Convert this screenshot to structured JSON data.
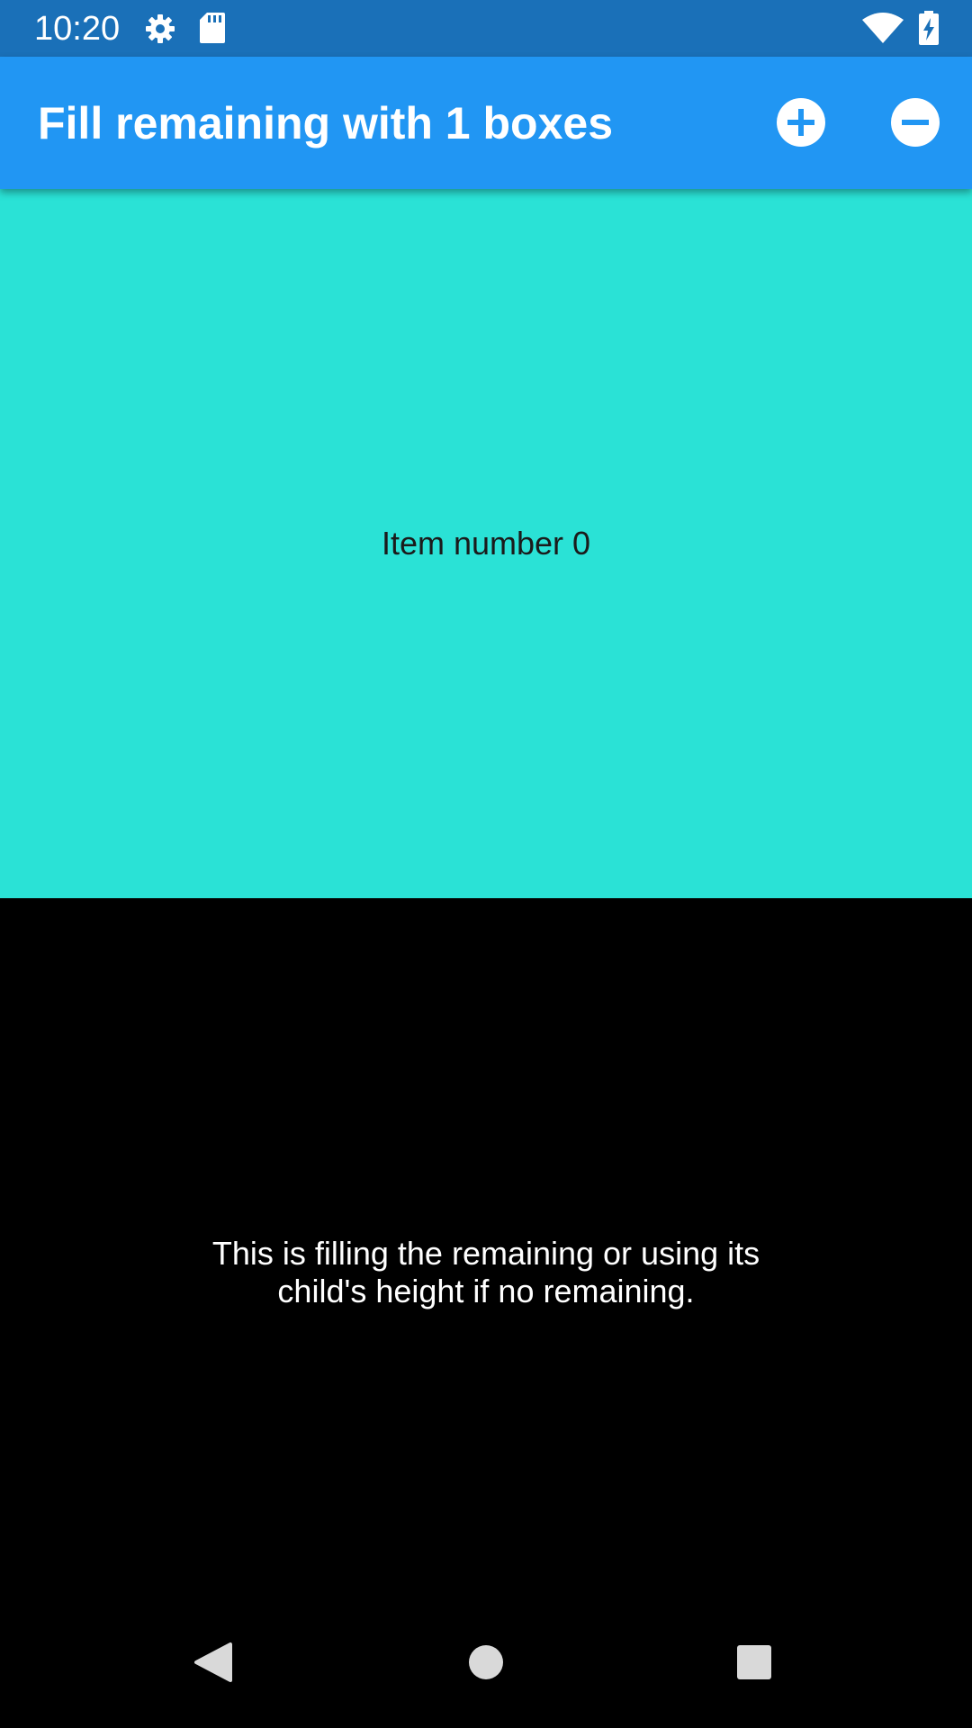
{
  "status_bar": {
    "time": "10:20",
    "left_icons": [
      "settings-gear-icon",
      "sd-card-icon"
    ],
    "right_icons": [
      "wifi-icon",
      "battery-charging-icon"
    ],
    "background": "#1a70b8"
  },
  "app_bar": {
    "title": "Fill remaining with 1 boxes",
    "background": "#2196f3",
    "actions": [
      {
        "name": "add",
        "icon": "add-circle-icon"
      },
      {
        "name": "remove",
        "icon": "remove-circle-icon"
      }
    ]
  },
  "content": {
    "item": {
      "label": "Item number 0",
      "color": "#2ae2d6"
    },
    "fill_remaining": {
      "text": "This is filling the remaining or using its child's height if no remaining.",
      "color": "#000000"
    }
  },
  "navigation_bar": {
    "buttons": [
      {
        "name": "back",
        "icon": "back-triangle-icon"
      },
      {
        "name": "home",
        "icon": "home-circle-icon"
      },
      {
        "name": "recents",
        "icon": "recents-square-icon"
      }
    ]
  }
}
